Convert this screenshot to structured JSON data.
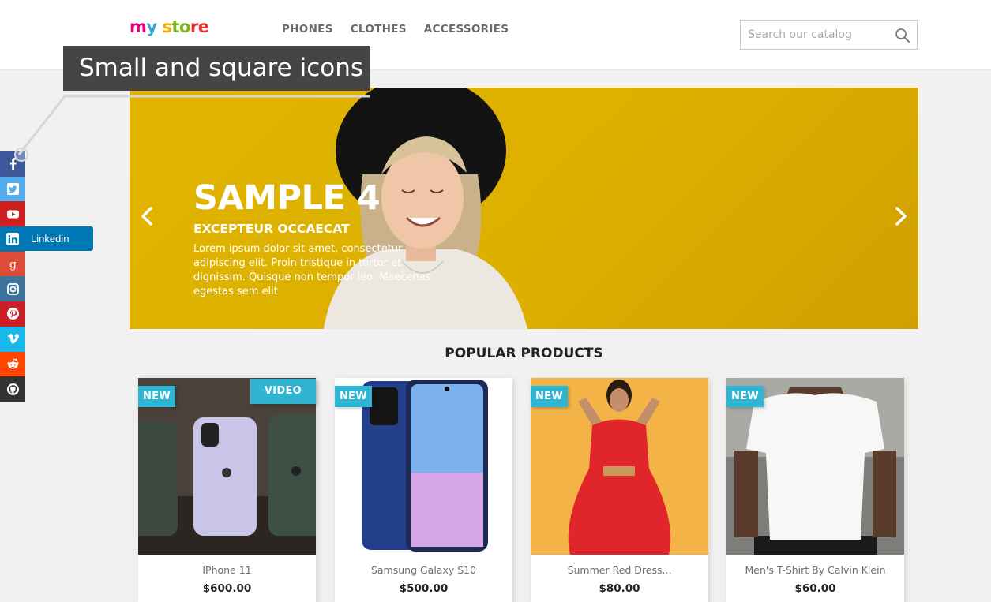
{
  "header": {
    "logo": {
      "part1": "m",
      "part2": "y",
      "part3": " s",
      "part4": "to",
      "part5": "re"
    },
    "nav": [
      "PHONES",
      "CLOTHES",
      "ACCESSORIES"
    ],
    "search": {
      "placeholder": "Search our catalog",
      "icon": "search-icon"
    }
  },
  "tooltip": {
    "text": "Small and square icons"
  },
  "slider": {
    "title": "SAMPLE 4",
    "subtitle": "EXCEPTEUR OCCAECAT",
    "description": "Lorem ipsum dolor sit amet, consectetur adipiscing elit. Proin tristique in tortor et dignissim. Quisque non tempor leo. Maecenas egestas sem elit",
    "background_color": "#e0b400"
  },
  "popular": {
    "title": "POPULAR PRODUCTS",
    "products": [
      {
        "name": "IPhone 11",
        "price": "$600.00",
        "badge": "NEW",
        "extra_badge": "VIDEO"
      },
      {
        "name": "Samsung Galaxy S10",
        "price": "$500.00",
        "badge": "NEW"
      },
      {
        "name": "Summer Red Dress...",
        "price": "$80.00",
        "badge": "NEW"
      },
      {
        "name": "Men's T-Shirt By Calvin Klein",
        "price": "$60.00",
        "badge": "NEW"
      }
    ]
  },
  "social": {
    "items": [
      {
        "name": "facebook",
        "color": "#3b5998"
      },
      {
        "name": "twitter",
        "color": "#55acee"
      },
      {
        "name": "youtube",
        "color": "#cd201f"
      },
      {
        "name": "linkedin",
        "color": "#0077b5"
      },
      {
        "name": "googleplus",
        "color": "#dd4b39"
      },
      {
        "name": "instagram",
        "color": "#3f729b"
      },
      {
        "name": "pinterest",
        "color": "#cb2027"
      },
      {
        "name": "vimeo",
        "color": "#1ab7ea"
      },
      {
        "name": "reddit",
        "color": "#ff4500"
      },
      {
        "name": "github",
        "color": "#333333"
      }
    ],
    "linkedin_label": "Linkedin"
  },
  "colors": {
    "accent": "#2fb5d2"
  }
}
